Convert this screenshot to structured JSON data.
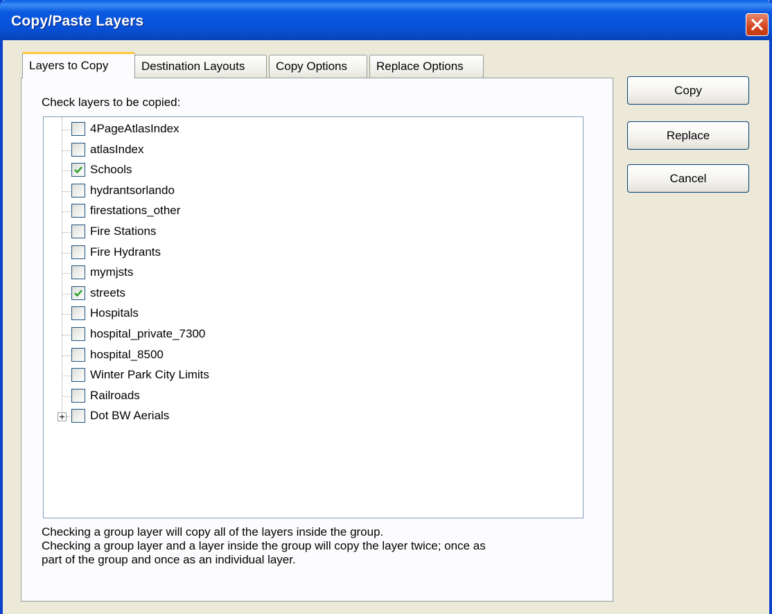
{
  "window": {
    "title": "Copy/Paste Layers"
  },
  "tabs": [
    {
      "label": "Layers to Copy",
      "active": true
    },
    {
      "label": "Destination Layouts",
      "active": false
    },
    {
      "label": "Copy Options",
      "active": false
    },
    {
      "label": "Replace Options",
      "active": false
    }
  ],
  "panel": {
    "instruction": "Check layers to be copied:",
    "layers": [
      {
        "label": "4PageAtlasIndex",
        "checked": false
      },
      {
        "label": "atlasIndex",
        "checked": false
      },
      {
        "label": "Schools",
        "checked": true
      },
      {
        "label": "hydrantsorlando",
        "checked": false
      },
      {
        "label": "firestations_other",
        "checked": false
      },
      {
        "label": "Fire Stations",
        "checked": false
      },
      {
        "label": "Fire Hydrants",
        "checked": false
      },
      {
        "label": "mymjsts",
        "checked": false
      },
      {
        "label": "streets",
        "checked": true
      },
      {
        "label": "Hospitals",
        "checked": false
      },
      {
        "label": "hospital_private_7300",
        "checked": false
      },
      {
        "label": "hospital_8500",
        "checked": false
      },
      {
        "label": "Winter Park City Limits",
        "checked": false
      },
      {
        "label": "Railroads",
        "checked": false
      },
      {
        "label": "Dot BW Aerials",
        "checked": false,
        "expandable": true
      }
    ],
    "note_1": "Checking a group layer will copy all of the layers inside the group.",
    "note_2": "Checking a group layer and a layer inside the group will copy the layer twice; once as\npart of the group and once as an individual layer."
  },
  "buttons": {
    "copy": "Copy",
    "replace": "Replace",
    "cancel": "Cancel"
  },
  "colors": {
    "titlebar": "#0851D8",
    "dialog_bg": "#ECE9D8",
    "check_mark": "#21A121",
    "tab_highlight": "#FFC83C"
  },
  "icons": {
    "close": "close-icon",
    "check": "check-icon",
    "expand": "plus-expander-icon"
  }
}
